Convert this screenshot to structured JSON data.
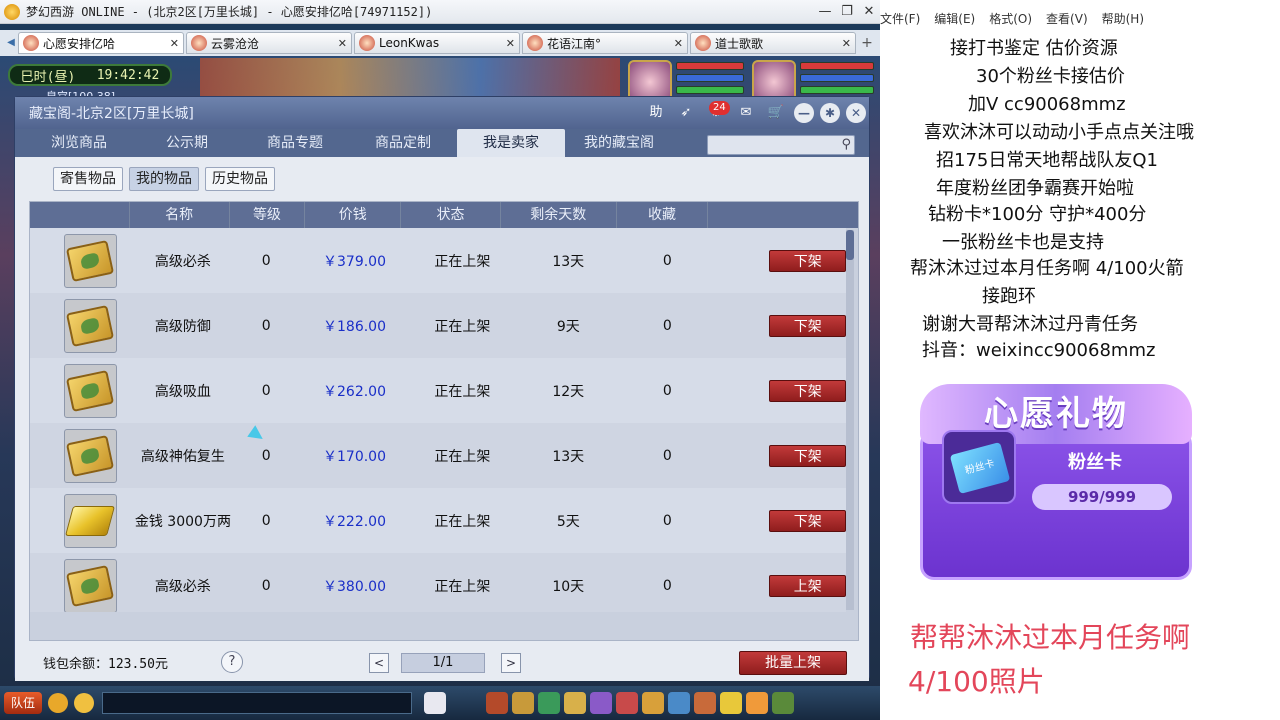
{
  "window": {
    "title": "梦幻西游 ONLINE - (北京2区[万里长城] - 心愿安排亿哈[74971152])",
    "minimize": "—",
    "restore": "❐",
    "close": "✕"
  },
  "client_tabs": [
    {
      "label": "心愿安排亿哈",
      "active": true
    },
    {
      "label": "云雾沧沧",
      "active": false
    },
    {
      "label": "LeonKwas",
      "active": false
    },
    {
      "label": "花语江南°",
      "active": false
    },
    {
      "label": "道士歌歌",
      "active": false
    }
  ],
  "tab_close": "✕",
  "tab_add": "+",
  "hud": {
    "time_period": "巳时(昼)",
    "clock": "19:42:42",
    "coords": "皇宫[100,38]"
  },
  "dialog": {
    "title": "藏宝阁-北京2区[万里长城]",
    "help_label": "助",
    "message_count": "24",
    "tabs": [
      "浏览商品",
      "公示期",
      "商品专题",
      "商品定制",
      "我是卖家",
      "我的藏宝阁"
    ],
    "active_tab": 4,
    "search_placeholder": "",
    "subtabs": [
      "寄售物品",
      "我的物品",
      "历史物品"
    ],
    "active_subtab": 1,
    "columns": [
      "名称",
      "等级",
      "价钱",
      "状态",
      "剩余天数",
      "收藏"
    ],
    "rows": [
      {
        "icon": "scroll-icon",
        "name": "高级必杀",
        "level": "0",
        "price": "￥379.00",
        "status": "正在上架",
        "days": "13天",
        "fav": "0",
        "action": "下架"
      },
      {
        "icon": "scroll-icon",
        "name": "高级防御",
        "level": "0",
        "price": "￥186.00",
        "status": "正在上架",
        "days": "9天",
        "fav": "0",
        "action": "下架"
      },
      {
        "icon": "scroll-icon",
        "name": "高级吸血",
        "level": "0",
        "price": "￥262.00",
        "status": "正在上架",
        "days": "12天",
        "fav": "0",
        "action": "下架"
      },
      {
        "icon": "scroll-icon",
        "name": "高级神佑复生",
        "level": "0",
        "price": "￥170.00",
        "status": "正在上架",
        "days": "13天",
        "fav": "0",
        "action": "下架"
      },
      {
        "icon": "gold-bar-icon",
        "name": "金钱 3000万两",
        "level": "0",
        "price": "￥222.00",
        "status": "正在上架",
        "days": "5天",
        "fav": "0",
        "action": "下架"
      },
      {
        "icon": "scroll-icon",
        "name": "高级必杀",
        "level": "0",
        "price": "￥380.00",
        "status": "正在上架",
        "days": "10天",
        "fav": "0",
        "action": "上架"
      }
    ],
    "wallet": "钱包余额：123.50元",
    "help_q": "?",
    "page": "1/1",
    "prev": "<",
    "next": ">",
    "bulk_button": "批量上架"
  },
  "bottom_bar": {
    "team_button": "队伍"
  },
  "notepad": {
    "menu": [
      "文件(F)",
      "编辑(E)",
      "格式(O)",
      "查看(V)",
      "帮助(H)"
    ],
    "lines": [
      "接打书鉴定 估价资源",
      "30个粉丝卡接估价",
      "加V  cc90068mmz",
      "喜欢沐沐可以动动小手点点关注哦",
      "招175日常天地帮战队友Q1",
      "年度粉丝团争霸赛开始啦",
      "钻粉卡*100分  守护*400分",
      "一张粉丝卡也是支持",
      "帮沐沐过过本月任务啊  4/100火箭",
      "接跑环",
      "谢谢大哥帮沐沐过丹青任务",
      "抖音：weixincc90068mmz"
    ]
  },
  "gift": {
    "header": "心愿礼物",
    "card_icon_text": "粉丝卡",
    "name": "粉丝卡",
    "progress": "999/999"
  },
  "promo": {
    "line1": "帮帮沐沐过本月任务啊",
    "line2": "4/100照片"
  },
  "colors": {
    "accent_red": "#e3465a",
    "price_blue": "#1a2fc8",
    "dialog_blue": "#5c6f9a",
    "gift_purple": "#7a42dc"
  }
}
